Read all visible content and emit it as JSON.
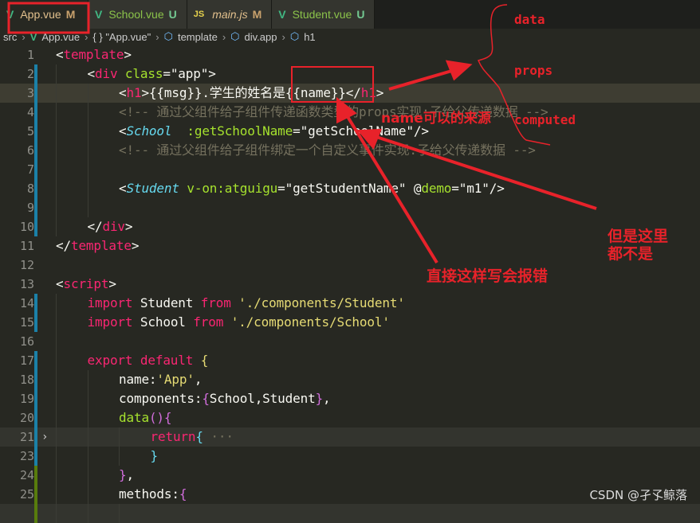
{
  "tabs": [
    {
      "label": "App.vue",
      "status": "M",
      "icon": "vue-icon",
      "active": true,
      "dirty": true
    },
    {
      "label": "School.vue",
      "status": "U",
      "icon": "vue-icon"
    },
    {
      "label": "main.js",
      "status": "M",
      "icon": "js-icon",
      "italic": true
    },
    {
      "label": "Student.vue",
      "status": "U",
      "icon": "vue-icon"
    }
  ],
  "breadcrumb": [
    "src",
    "App.vue",
    "{ } \"App.vue\"",
    "template",
    "div.app",
    "h1"
  ],
  "colors": {
    "tag": "#f92672",
    "attr": "#a6e22e",
    "string": "#e6db74",
    "comp": "#66d9ef",
    "comment": "#75715e",
    "text": "#f8f8f2",
    "brace": "#d16ddc",
    "annotation": "#e8222a"
  },
  "lines": [
    {
      "n": "1",
      "indent": 0,
      "tokens": [
        [
          "<",
          "text"
        ],
        [
          "template",
          "tag"
        ],
        [
          ">",
          "text"
        ]
      ]
    },
    {
      "n": "2",
      "indent": 1,
      "bar": "blue",
      "tokens": [
        [
          "<",
          "text"
        ],
        [
          "div",
          "tag"
        ],
        [
          " class",
          "attr"
        ],
        [
          "=\"app\">",
          "text"
        ]
      ]
    },
    {
      "n": "3",
      "indent": 2,
      "bar": "blue",
      "hl": true,
      "tokens": [
        [
          "<",
          "text"
        ],
        [
          "h1",
          "tag"
        ],
        [
          ">{{msg}}.学生的姓名是{{name}}</",
          "text"
        ],
        [
          "h1",
          "tag"
        ],
        [
          ">",
          "text"
        ]
      ]
    },
    {
      "n": "4",
      "indent": 2,
      "bar": "blue",
      "tokens": [
        [
          "<!-- 通过父组件给子组件传递函数类型的props实现:子给父传递数据 -->",
          "comment"
        ]
      ]
    },
    {
      "n": "5",
      "indent": 2,
      "bar": "blue",
      "tokens": [
        [
          "<",
          "text"
        ],
        [
          "School",
          "comp"
        ],
        [
          "  :getSchoolName",
          "attr"
        ],
        [
          "=\"getSchoolName\"/>",
          "text"
        ]
      ]
    },
    {
      "n": "6",
      "indent": 2,
      "bar": "blue",
      "tokens": [
        [
          "<!-- 通过父组件给子组件绑定一个自定义事件实现:子给父传递数据 -->",
          "comment"
        ]
      ]
    },
    {
      "n": "7",
      "indent": 2,
      "bar": "blue",
      "tokens": []
    },
    {
      "n": "8",
      "indent": 2,
      "bar": "blue",
      "tokens": [
        [
          "<",
          "text"
        ],
        [
          "Student",
          "comp"
        ],
        [
          " v-on:",
          "attr"
        ],
        [
          "atguigu",
          "attr"
        ],
        [
          "=\"getStudentName\" @",
          "text"
        ],
        [
          "demo",
          "attr"
        ],
        [
          "=\"m1\"/>",
          "text"
        ]
      ]
    },
    {
      "n": "9",
      "indent": 2,
      "bar": "blue",
      "tokens": []
    },
    {
      "n": "10",
      "indent": 1,
      "bar": "blue",
      "tokens": [
        [
          "</",
          "text"
        ],
        [
          "div",
          "tag"
        ],
        [
          ">",
          "text"
        ]
      ]
    },
    {
      "n": "11",
      "indent": 0,
      "tokens": [
        [
          "</",
          "text"
        ],
        [
          "template",
          "tag"
        ],
        [
          ">",
          "text"
        ]
      ]
    },
    {
      "n": "12",
      "indent": 0,
      "tokens": []
    },
    {
      "n": "13",
      "indent": 0,
      "tokens": [
        [
          "<",
          "text"
        ],
        [
          "script",
          "tag"
        ],
        [
          ">",
          "text"
        ]
      ]
    },
    {
      "n": "14",
      "indent": 1,
      "bar": "blue",
      "tokens": [
        [
          "import",
          "tag"
        ],
        [
          " Student ",
          "text"
        ],
        [
          "from",
          "tag"
        ],
        [
          " './components/Student'",
          "string"
        ]
      ]
    },
    {
      "n": "15",
      "indent": 1,
      "bar": "blue",
      "tokens": [
        [
          "import",
          "tag"
        ],
        [
          " School ",
          "text"
        ],
        [
          "from",
          "tag"
        ],
        [
          " './components/School'",
          "string"
        ]
      ]
    },
    {
      "n": "16",
      "indent": 1,
      "tokens": []
    },
    {
      "n": "17",
      "indent": 1,
      "bar": "blue",
      "tokens": [
        [
          "export default ",
          "tag"
        ],
        [
          "{",
          "string"
        ]
      ]
    },
    {
      "n": "18",
      "indent": 2,
      "bar": "blue",
      "tokens": [
        [
          "name:",
          "text"
        ],
        [
          "'App'",
          "string"
        ],
        [
          ",",
          "text"
        ]
      ]
    },
    {
      "n": "19",
      "indent": 2,
      "bar": "blue",
      "tokens": [
        [
          "components:",
          "text"
        ],
        [
          "{",
          "brace"
        ],
        [
          "School,Student",
          "text"
        ],
        [
          "}",
          "brace"
        ],
        [
          ",",
          "text"
        ]
      ]
    },
    {
      "n": "20",
      "indent": 2,
      "bar": "blue",
      "tokens": [
        [
          "data",
          "attr"
        ],
        [
          "()",
          "brace"
        ],
        [
          "{",
          "brace"
        ]
      ]
    },
    {
      "n": "21",
      "indent": 3,
      "bar": "blue",
      "hl2": true,
      "fold": true,
      "tokens": [
        [
          "return",
          "tag"
        ],
        [
          "{",
          "comp"
        ],
        [
          " ···",
          "comment"
        ]
      ]
    },
    {
      "n": "23",
      "indent": 3,
      "bar": "blue",
      "tokens": [
        [
          "}",
          "comp"
        ]
      ]
    },
    {
      "n": "24",
      "indent": 2,
      "bar": "green",
      "tokens": [
        [
          "}",
          "brace"
        ],
        [
          ",",
          "text"
        ]
      ]
    },
    {
      "n": "25",
      "indent": 2,
      "bar": "green",
      "tokens": [
        [
          "methods:",
          "text"
        ],
        [
          "{",
          "brace"
        ]
      ]
    },
    {
      "n": "",
      "indent": 3,
      "bar": "green",
      "hl2": true,
      "tokens": []
    }
  ],
  "annotations": {
    "data": "data",
    "props": "props",
    "computed": "computed",
    "source": "name可以的来源",
    "error": "直接这样写会报错",
    "none_line1": "但是这里",
    "none_line2": "都不是"
  },
  "watermark": "CSDN @孑孓鲸落"
}
